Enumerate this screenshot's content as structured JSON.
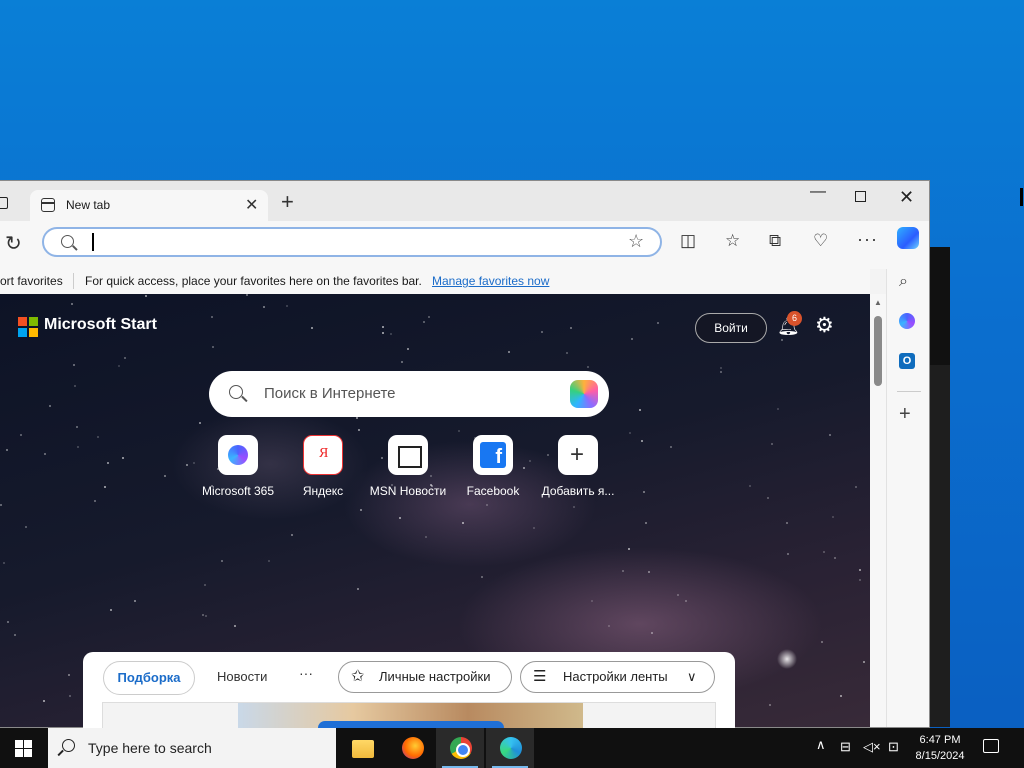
{
  "browser": {
    "tab_title": "New tab",
    "address_value": "",
    "favorites_bar": {
      "import_label": "ort favorites",
      "hint": "For quick access, place your favorites here on the favorites bar.",
      "manage_link": "Manage favorites now"
    }
  },
  "ms_start": {
    "brand": "Microsoft Start",
    "login_label": "Войти",
    "notification_count": "6",
    "search_placeholder": "Поиск в Интернете",
    "quick_links": [
      {
        "label": "Microsoft 365",
        "icon": "microsoft365-icon"
      },
      {
        "label": "Яндекс",
        "icon": "yandex-icon"
      },
      {
        "label": "MSN Новости",
        "icon": "msn-news-icon"
      },
      {
        "label": "Facebook",
        "icon": "facebook-icon"
      },
      {
        "label": "Добавить я...",
        "icon": "add-icon"
      }
    ],
    "feed_tabs": {
      "podborka": "Подборка",
      "news": "Новости",
      "more": "···",
      "personal": "Личные настройки",
      "feed_settings": "Настройки ленты"
    }
  },
  "taskbar": {
    "search_placeholder": "Type here to search",
    "time": "6:47 PM",
    "date": "8/15/2024",
    "apps": [
      "file-explorer-icon",
      "firefox-icon",
      "chrome-icon",
      "edge-icon"
    ]
  },
  "colors": {
    "desktop": "#0b6fcf",
    "accent": "#1b6cc9",
    "badge": "#d9532c"
  }
}
